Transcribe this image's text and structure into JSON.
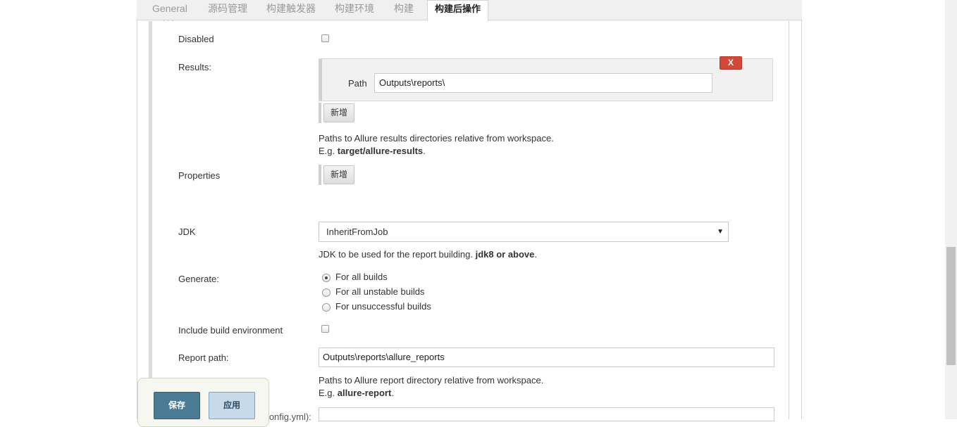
{
  "tabs": [
    "General",
    "源码管理",
    "构建触发器",
    "构建环境",
    "构建",
    "构建后操作"
  ],
  "active_tab": "构建后操作",
  "form": {
    "disabled_label": "Disabled",
    "results_label": "Results:",
    "path_label": "Path",
    "path_value": "Outputs\\reports\\",
    "delete_label": "X",
    "add_label": "新增",
    "results_help_line1": "Paths to Allure results directories relative from workspace.",
    "results_help_prefix": "E.g. ",
    "results_help_example": "target/allure-results",
    "results_help_suffix": ".",
    "properties_label": "Properties",
    "jdk_label": "JDK",
    "jdk_value": "InheritFromJob",
    "jdk_help_text": "JDK to be used for the report building. ",
    "jdk_help_bold": "jdk8 or above",
    "jdk_help_suffix": ".",
    "generate_label": "Generate:",
    "generate_options": [
      "For all builds",
      "For all unstable builds",
      "For unsuccessful builds"
    ],
    "generate_selected": "For all builds",
    "include_env_label": "Include build environment",
    "report_path_label": "Report path:",
    "report_path_value": "Outputs\\reports\\allure_reports",
    "report_help_line1": "Paths to Allure report directory relative from workspace.",
    "report_help_prefix": "E.g. ",
    "report_help_example": "allure-report",
    "report_help_suffix": ".",
    "config_label_partial": "(config.yml):"
  },
  "actions": {
    "save_label": "保存",
    "apply_label": "应用"
  },
  "colors": {
    "delete_button": "#d24939",
    "save_button": "#4a7a94",
    "apply_button": "#c7daea"
  }
}
